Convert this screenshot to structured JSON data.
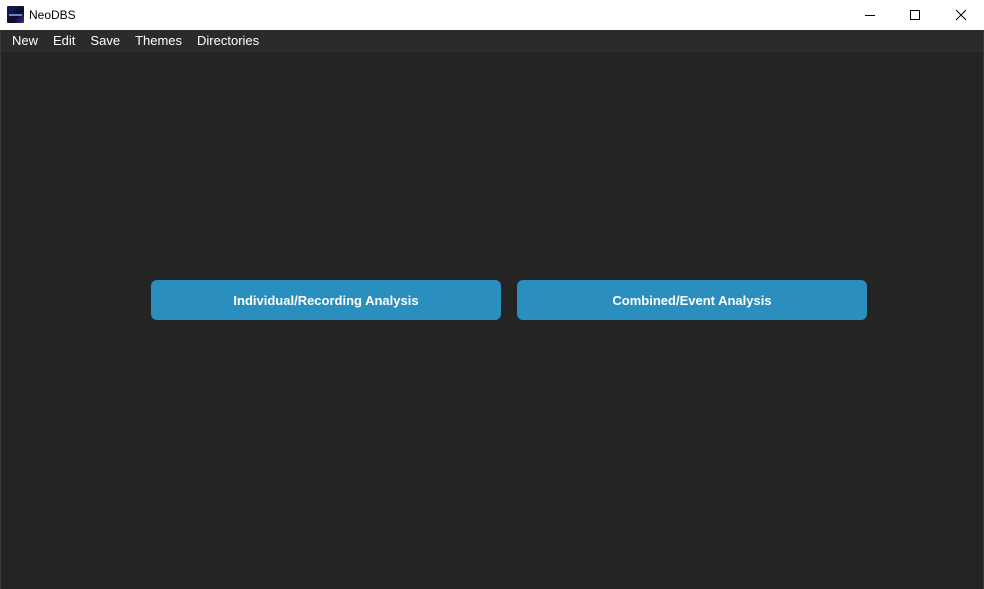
{
  "window": {
    "title": "NeoDBS",
    "icon": "app-logo-icon",
    "controls": {
      "minimize_icon": "minimize-icon",
      "maximize_icon": "maximize-icon",
      "close_icon": "close-icon"
    }
  },
  "menubar": {
    "items": [
      {
        "label": "New"
      },
      {
        "label": "Edit"
      },
      {
        "label": "Save"
      },
      {
        "label": "Themes"
      },
      {
        "label": "Directories"
      }
    ]
  },
  "main": {
    "buttons": [
      {
        "label": "Individual/Recording Analysis"
      },
      {
        "label": "Combined/Event Analysis"
      }
    ]
  },
  "colors": {
    "menubar_bg": "#2b2b2b",
    "content_bg": "#242424",
    "button_bg": "#2a8fbe",
    "button_text": "#ffffff"
  }
}
